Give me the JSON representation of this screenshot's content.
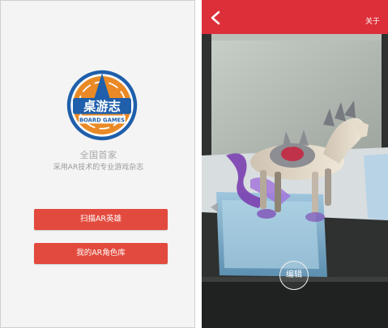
{
  "home": {
    "logo": {
      "text_main": "桌游志",
      "text_sub": "BOARD GAMES",
      "colors": {
        "ring_orange": "#e98a26",
        "blue": "#1f5fab",
        "white": "#ffffff"
      }
    },
    "tagline_title": "全国首家",
    "tagline_sub": "采用AR技术的专业游戏杂志",
    "buttons": {
      "scan_label": "扫描AR英雄",
      "library_label": "我的AR角色库"
    },
    "accent_color": "#e24a3d"
  },
  "ar_view": {
    "topbar_color": "#dc2f3a",
    "back_icon": "chevron-left-icon",
    "about_label": "关于",
    "edit_label": "编辑"
  }
}
